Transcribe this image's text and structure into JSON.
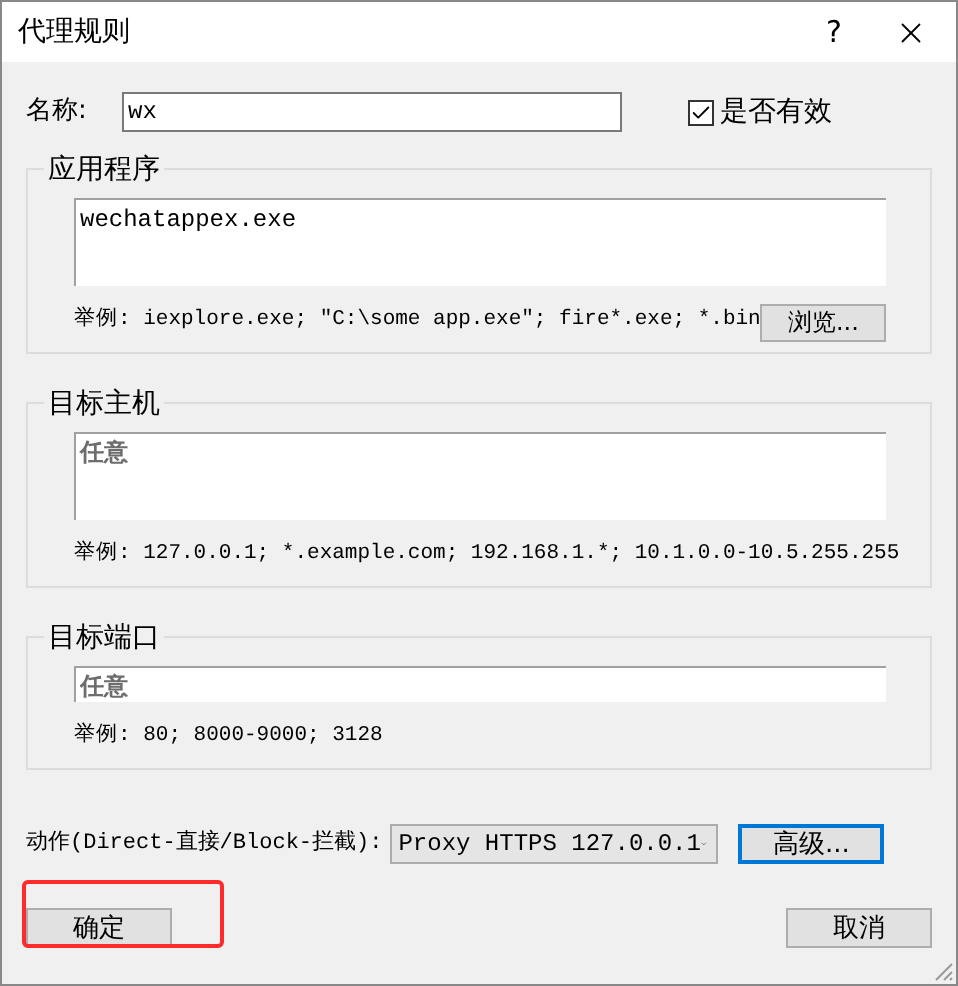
{
  "window": {
    "title": "代理规则",
    "help": "?"
  },
  "name_row": {
    "label": "名称:",
    "value": "wx",
    "checkbox": {
      "label": "是否有效",
      "checked": true
    }
  },
  "groups": [
    {
      "title": "应用程序",
      "kind": "textarea",
      "value": "wechatappex.exe",
      "example": "举例: iexplore.exe; \"C:\\some app.exe\"; fire*.exe; *.bin",
      "button": "浏览..."
    },
    {
      "title": "目标主机",
      "kind": "textarea",
      "placeholder": "任意",
      "example": "举例: 127.0.0.1; *.example.com; 192.168.1.*; 10.1.0.0-10.5.255.255"
    },
    {
      "title": "目标端口",
      "kind": "input",
      "placeholder": "任意",
      "example": "举例: 80; 8000-9000; 3128"
    }
  ],
  "action": {
    "label": "动作(Direct-直接/Block-拦截):",
    "value": "Proxy HTTPS 127.0.0.1",
    "button": {
      "label": "高级...",
      "focused": true
    }
  },
  "buttons": [
    {
      "label": "确定",
      "highlighted": true
    },
    {
      "label": "取消",
      "highlighted": false
    }
  ]
}
